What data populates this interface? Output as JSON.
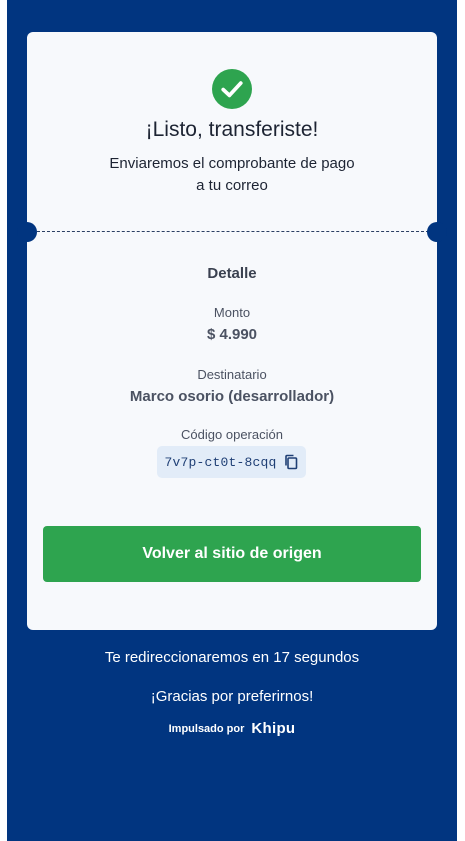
{
  "card": {
    "title": "¡Listo, transferiste!",
    "subtitle_line1": "Enviaremos el comprobante de pago",
    "subtitle_line2": "a tu correo"
  },
  "detail": {
    "heading": "Detalle",
    "amount_label": "Monto",
    "amount_value": "$ 4.990",
    "recipient_label": "Destinatario",
    "recipient_value": "Marco osorio (desarrollador)",
    "operation_label": "Código operación",
    "operation_code": "7v7p-ct0t-8cqq"
  },
  "actions": {
    "return_button": "Volver al sitio de origen"
  },
  "footer": {
    "redirect_text": "Te redireccionaremos en 17 segundos",
    "thanks_text": "¡Gracias por preferirnos!",
    "powered_by": "Impulsado por",
    "brand": "Khipu"
  },
  "icons": {
    "success": "check-circle-icon",
    "copy": "copy-icon"
  },
  "colors": {
    "background": "#013580",
    "card": "#f7f9fc",
    "success": "#2ea44f",
    "chip": "#e2ecf8"
  }
}
